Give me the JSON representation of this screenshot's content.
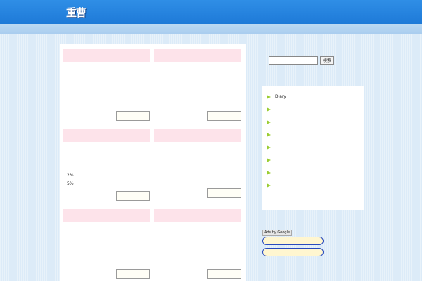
{
  "header": {
    "logo": {
      "left": "重曹",
      "middle": "",
      "right": ""
    },
    "nav": [
      "",
      "",
      ""
    ],
    "tagline": ""
  },
  "cards": [
    {
      "title": "",
      "items": [
        "",
        "",
        "",
        "",
        ""
      ],
      "more": ""
    },
    {
      "title": "",
      "items": [
        "",
        "",
        "",
        "",
        ""
      ],
      "more": ""
    },
    {
      "title": "",
      "items": [
        "",
        "",
        "",
        "2%",
        "5%"
      ],
      "more": ""
    },
    {
      "title": "",
      "items": [
        "",
        "",
        ""
      ],
      "more": ""
    },
    {
      "title": "",
      "items": [
        ""
      ],
      "more": ""
    },
    {
      "title": "",
      "items": [
        "",
        ""
      ],
      "more": ""
    }
  ],
  "sidebar": {
    "search": {
      "heading": "",
      "placeholder": "",
      "button": "検索"
    },
    "categories": {
      "heading": "",
      "items": [
        "Diary",
        "",
        "",
        "",
        "",
        "",
        "",
        ""
      ]
    },
    "links": {
      "heading": "",
      "ads_label": "Ads by Google",
      "buttons": [
        "",
        ""
      ]
    }
  },
  "colors": {
    "header_blue": "#1e7ad8",
    "card_title_pink": "#fde3ea",
    "bullet_green": "#9acd32",
    "pill_border": "#2a4bbd"
  }
}
